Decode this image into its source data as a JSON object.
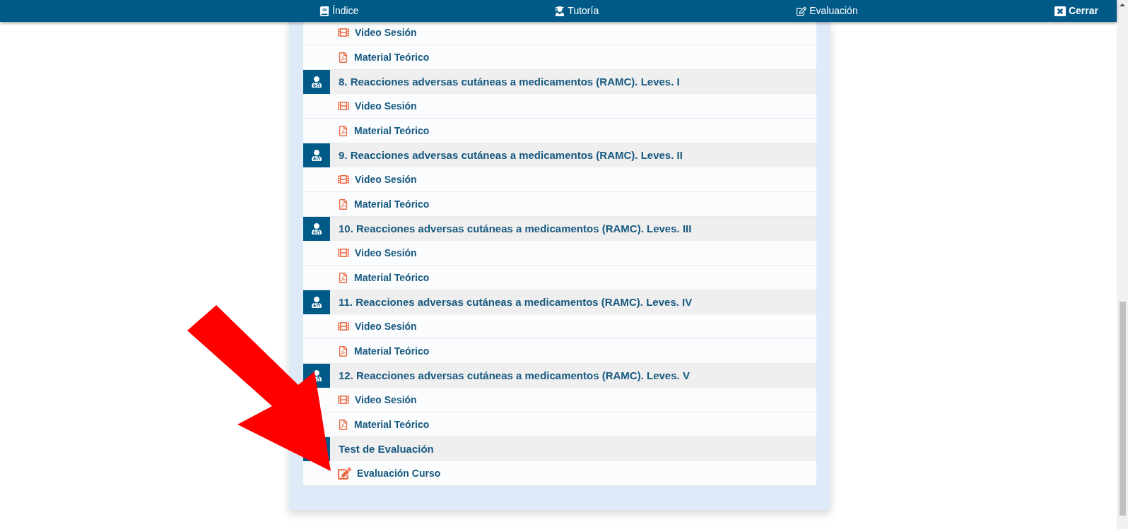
{
  "nav": {
    "items": [
      {
        "kind": "index",
        "label": "Índice"
      },
      {
        "kind": "tutoring",
        "label": "Tutoría"
      },
      {
        "kind": "evaluation",
        "label": "Evaluación"
      }
    ],
    "close": "Cerrar"
  },
  "sections": [
    {
      "items": [
        {
          "kind": "video",
          "label": "Video Sesión"
        },
        {
          "kind": "pdf",
          "label": "Material Teórico"
        }
      ]
    },
    {
      "title": "8. Reacciones adversas cutáneas a medicamentos (RAMC). Leves. I",
      "items": [
        {
          "kind": "video",
          "label": "Video Sesión"
        },
        {
          "kind": "pdf",
          "label": "Material Teórico"
        }
      ]
    },
    {
      "title": "9. Reacciones adversas cutáneas a medicamentos (RAMC). Leves. II",
      "items": [
        {
          "kind": "video",
          "label": "Video Sesión"
        },
        {
          "kind": "pdf",
          "label": "Material Teórico"
        }
      ]
    },
    {
      "title": "10. Reacciones adversas cutáneas a medicamentos (RAMC). Leves. III",
      "items": [
        {
          "kind": "video",
          "label": "Video Sesión"
        },
        {
          "kind": "pdf",
          "label": "Material Teórico"
        }
      ]
    },
    {
      "title": "11. Reacciones adversas cutáneas a medicamentos (RAMC). Leves. IV",
      "items": [
        {
          "kind": "video",
          "label": "Video Sesión"
        },
        {
          "kind": "pdf",
          "label": "Material Teórico"
        }
      ]
    },
    {
      "title": "12. Reacciones adversas cutáneas a medicamentos (RAMC). Leves. V",
      "items": [
        {
          "kind": "video",
          "label": "Video Sesión"
        },
        {
          "kind": "pdf",
          "label": "Material Teórico"
        }
      ]
    },
    {
      "title": "Test de Evaluación",
      "items": [
        {
          "kind": "edit",
          "label": "Evaluación Curso"
        }
      ]
    }
  ]
}
